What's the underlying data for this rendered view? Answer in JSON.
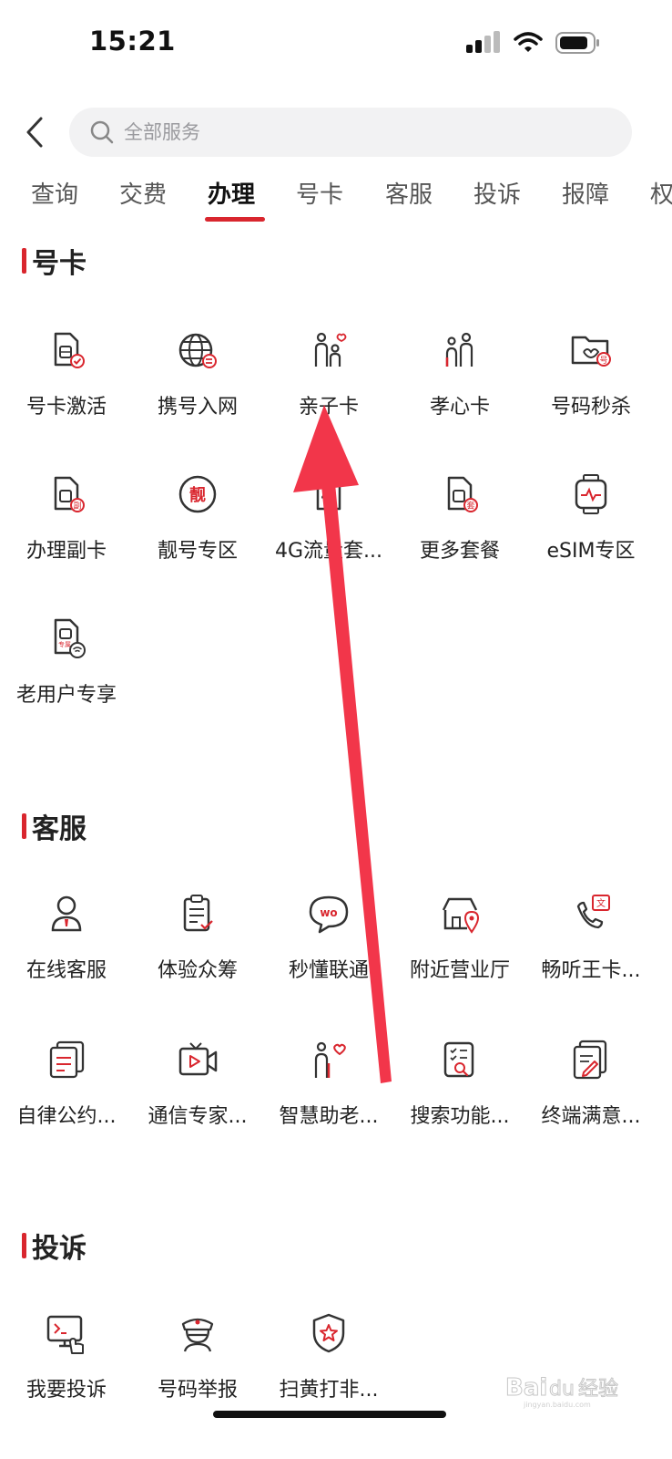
{
  "status": {
    "time": "15:21"
  },
  "search": {
    "placeholder": "全部服务"
  },
  "tabs": [
    "查询",
    "交费",
    "办理",
    "号卡",
    "客服",
    "投诉",
    "报障",
    "权"
  ],
  "sections": [
    {
      "title": "号卡",
      "items": [
        {
          "label": "号卡激活",
          "icon": "sim-check-icon"
        },
        {
          "label": "携号入网",
          "icon": "globe-transfer-icon"
        },
        {
          "label": "亲子卡",
          "icon": "parent-child-icon"
        },
        {
          "label": "孝心卡",
          "icon": "elder-care-icon"
        },
        {
          "label": "号码秒杀",
          "icon": "number-flash-sale-icon"
        },
        {
          "label": "办理副卡",
          "icon": "sim-secondary-icon"
        },
        {
          "label": "靓号专区",
          "icon": "premium-number-icon"
        },
        {
          "label": "4G流量套...",
          "icon": "4g-data-icon"
        },
        {
          "label": "更多套餐",
          "icon": "sim-plan-icon"
        },
        {
          "label": "eSIM专区",
          "icon": "esim-watch-icon"
        },
        {
          "label": "老用户专享",
          "icon": "sim-wifi-exclusive-icon"
        }
      ]
    },
    {
      "title": "客服",
      "items": [
        {
          "label": "在线客服",
          "icon": "agent-icon"
        },
        {
          "label": "体验众筹",
          "icon": "clipboard-check-icon"
        },
        {
          "label": "秒懂联通",
          "icon": "chat-bubble-icon"
        },
        {
          "label": "附近营业厅",
          "icon": "store-location-icon"
        },
        {
          "label": "畅听王卡...",
          "icon": "phone-text-icon"
        },
        {
          "label": "自律公约...",
          "icon": "document-stack-icon"
        },
        {
          "label": "通信专家...",
          "icon": "video-tv-icon"
        },
        {
          "label": "智慧助老...",
          "icon": "elder-heart-icon"
        },
        {
          "label": "搜索功能...",
          "icon": "search-doc-icon"
        },
        {
          "label": "终端满意...",
          "icon": "survey-edit-icon"
        }
      ]
    },
    {
      "title": "投诉",
      "items": [
        {
          "label": "我要投诉",
          "icon": "complaint-screen-icon"
        },
        {
          "label": "号码举报",
          "icon": "police-icon"
        },
        {
          "label": "扫黄打非...",
          "icon": "shield-star-icon"
        }
      ]
    }
  ],
  "watermark": {
    "text": "Baidu经验",
    "sub": "jingyan.baidu.com"
  },
  "colors": {
    "accent": "#d9262e",
    "icon_stroke": "#333333"
  }
}
